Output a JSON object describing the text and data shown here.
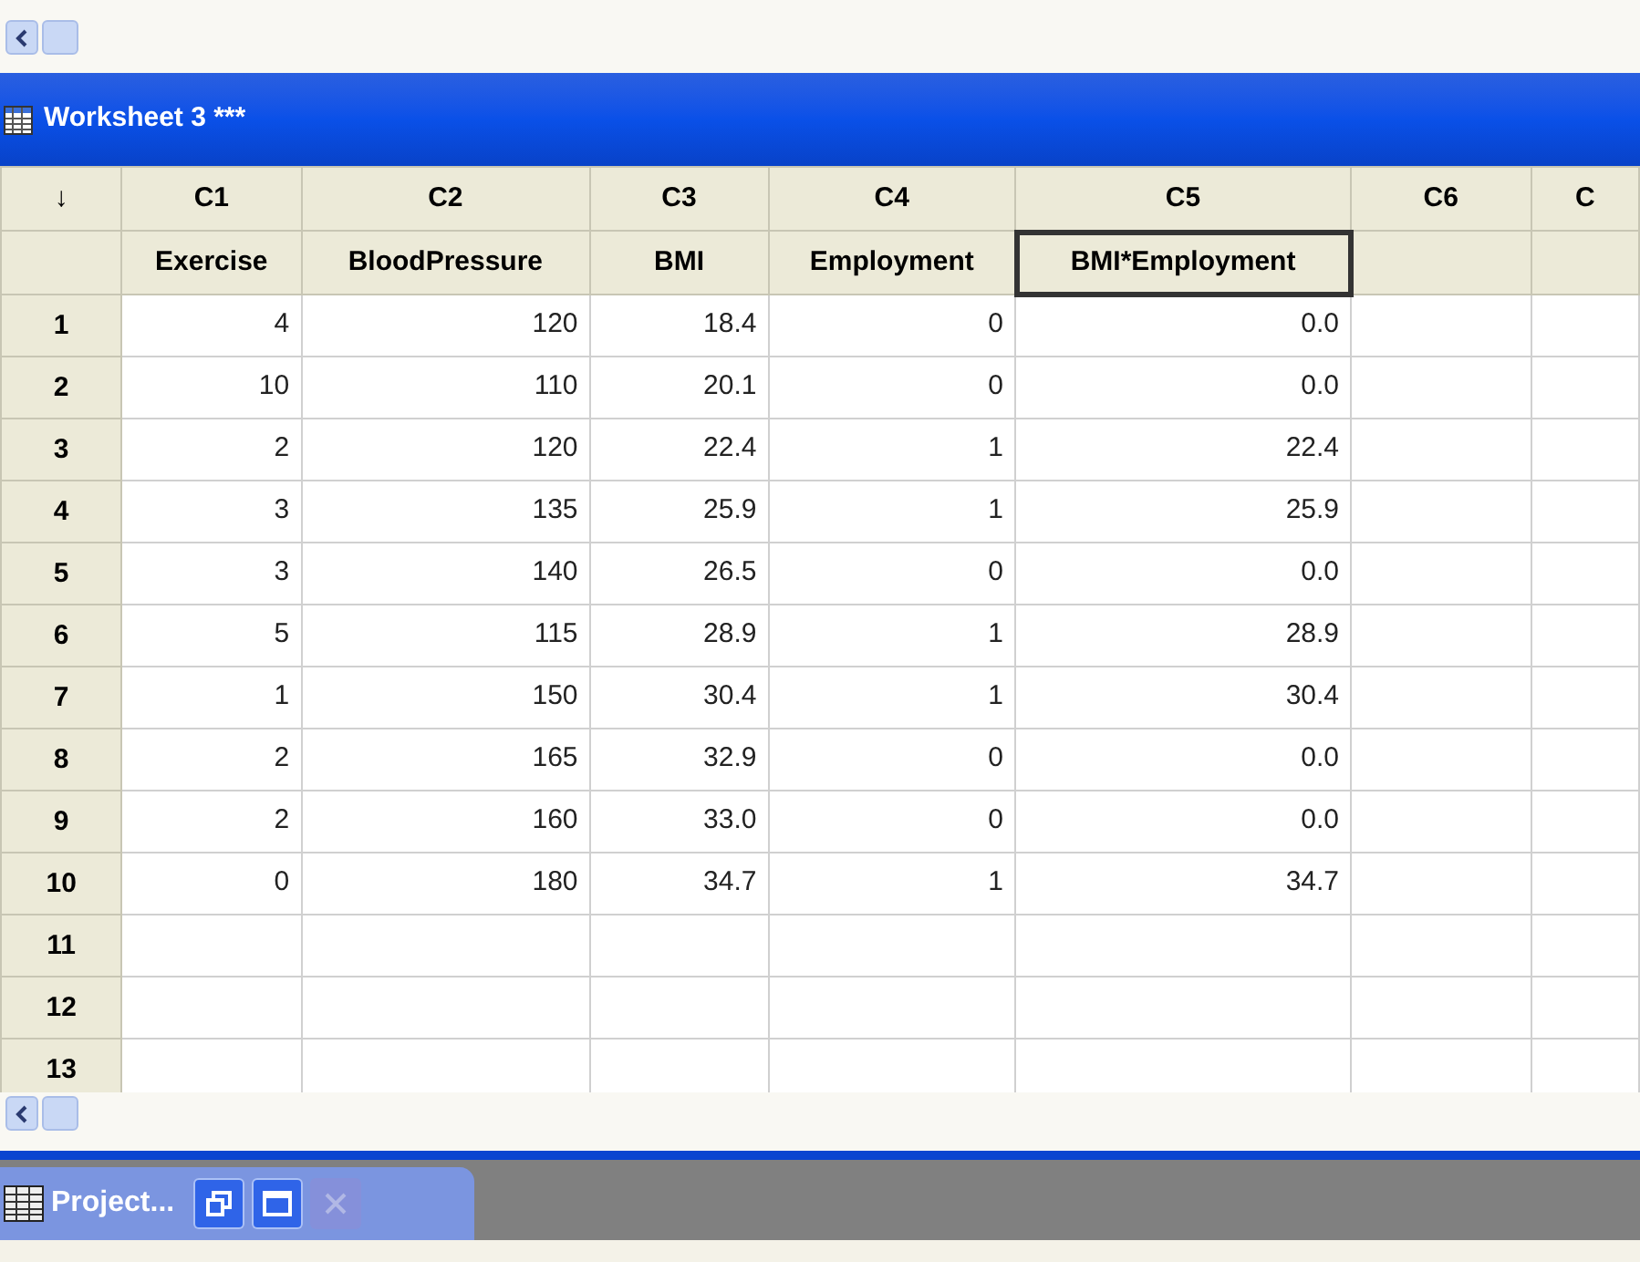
{
  "worksheet": {
    "title": "Worksheet 3 ***",
    "corner": "↓",
    "columns": [
      {
        "id": "C1",
        "name": "Exercise",
        "selected": false
      },
      {
        "id": "C2",
        "name": "BloodPressure",
        "selected": false
      },
      {
        "id": "C3",
        "name": "BMI",
        "selected": false
      },
      {
        "id": "C4",
        "name": "Employment",
        "selected": false
      },
      {
        "id": "C5",
        "name": "BMI*Employment",
        "selected": true
      },
      {
        "id": "C6",
        "selected": false
      },
      {
        "id": "C",
        "selected": false
      }
    ],
    "rows": [
      {
        "label": "1",
        "cells": [
          "4",
          "120",
          "18.4",
          "0",
          "0.0"
        ]
      },
      {
        "label": "2",
        "cells": [
          "10",
          "110",
          "20.1",
          "0",
          "0.0"
        ]
      },
      {
        "label": "3",
        "cells": [
          "2",
          "120",
          "22.4",
          "1",
          "22.4"
        ]
      },
      {
        "label": "4",
        "cells": [
          "3",
          "135",
          "25.9",
          "1",
          "25.9"
        ]
      },
      {
        "label": "5",
        "cells": [
          "3",
          "140",
          "26.5",
          "0",
          "0.0"
        ]
      },
      {
        "label": "6",
        "cells": [
          "5",
          "115",
          "28.9",
          "1",
          "28.9"
        ]
      },
      {
        "label": "7",
        "cells": [
          "1",
          "150",
          "30.4",
          "1",
          "30.4"
        ]
      },
      {
        "label": "8",
        "cells": [
          "2",
          "165",
          "32.9",
          "0",
          "0.0"
        ]
      },
      {
        "label": "9",
        "cells": [
          "2",
          "160",
          "33.0",
          "0",
          "0.0"
        ]
      },
      {
        "label": "10",
        "cells": [
          "0",
          "180",
          "34.7",
          "1",
          "34.7"
        ]
      },
      {
        "label": "11",
        "cells": []
      },
      {
        "label": "12",
        "cells": []
      },
      {
        "label": "13",
        "cells": []
      }
    ]
  },
  "minimized_window": {
    "title": "Project...",
    "close_disabled": true
  }
}
